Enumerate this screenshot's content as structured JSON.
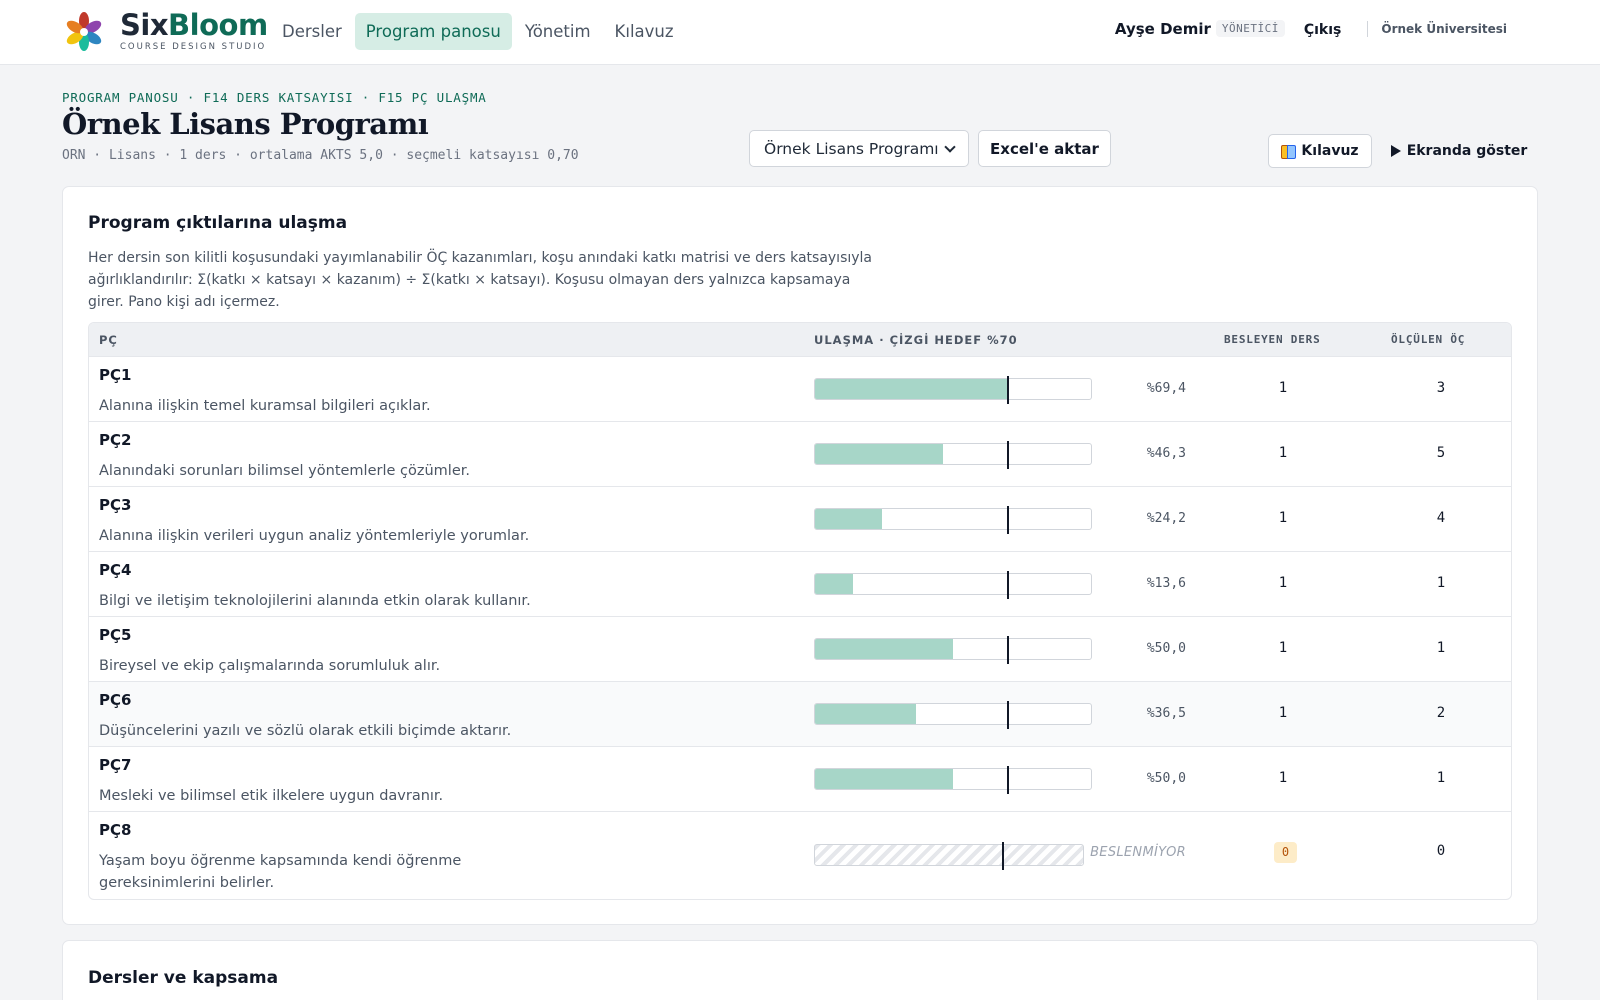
{
  "brand": {
    "name_part1": "Six",
    "name_part2": "Bloom",
    "tagline": "COURSE DESIGN STUDIO"
  },
  "nav": [
    {
      "label": "Dersler",
      "active": false
    },
    {
      "label": "Program panosu",
      "active": true
    },
    {
      "label": "Yönetim",
      "active": false
    },
    {
      "label": "Kılavuz",
      "active": false
    }
  ],
  "user": {
    "name": "Ayşe Demir",
    "role": "YÖNETİCİ",
    "logout": "Çıkış",
    "university": "Örnek Üniversitesi"
  },
  "header": {
    "breadcrumb": "PROGRAM PANOSU · F14 DERS KATSAYISI · F15 PÇ ULAŞMA",
    "title": "Örnek Lisans Programı",
    "subtitle": "ORN · Lisans · 1 ders · ortalama AKTS 5,0 · seçmeli katsayısı 0,70",
    "program_select": "Örnek Lisans Programı",
    "export_button": "Excel'e aktar",
    "guide_button": "Kılavuz",
    "present_button": "Ekranda göster"
  },
  "outcomes_card": {
    "title": "Program çıktılarına ulaşma",
    "description": "Her dersin son kilitli koşusundaki yayımlanabilir ÖÇ kazanımları, koşu anındaki katkı matrisi ve ders katsayısıyla ağırlıklandırılır: Σ(katkı × katsayı × kazanım) ÷ Σ(katkı × katsayı). Koşusu olmayan ders yalnızca kapsamaya girer. Pano kişi adı içermez.",
    "columns": {
      "pc": "PÇ",
      "achievement": "ULAŞMA · ÇİZGİ HEDEF %70",
      "feeding": "BESLEYEN DERS",
      "measured": "ÖLÇÜLEN ÖÇ"
    },
    "target": 0.7,
    "rows": [
      {
        "code": "PÇ1",
        "desc": "Alanına ilişkin temel kuramsal bilgileri açıklar.",
        "value": 0.694,
        "pct_label": "%69,4",
        "feeding": "1",
        "measured": "3"
      },
      {
        "code": "PÇ2",
        "desc": "Alanındaki sorunları bilimsel yöntemlerle çözümler.",
        "value": 0.463,
        "pct_label": "%46,3",
        "feeding": "1",
        "measured": "5"
      },
      {
        "code": "PÇ3",
        "desc": "Alanına ilişkin verileri uygun analiz yöntemleriyle yorumlar.",
        "value": 0.242,
        "pct_label": "%24,2",
        "feeding": "1",
        "measured": "4"
      },
      {
        "code": "PÇ4",
        "desc": "Bilgi ve iletişim teknolojilerini alanında etkin olarak kullanır.",
        "value": 0.136,
        "pct_label": "%13,6",
        "feeding": "1",
        "measured": "1"
      },
      {
        "code": "PÇ5",
        "desc": "Bireysel ve ekip çalışmalarında sorumluluk alır.",
        "value": 0.5,
        "pct_label": "%50,0",
        "feeding": "1",
        "measured": "1"
      },
      {
        "code": "PÇ6",
        "desc": "Düşüncelerini yazılı ve sözlü olarak etkili biçimde aktarır.",
        "value": 0.365,
        "pct_label": "%36,5",
        "feeding": "1",
        "measured": "2"
      },
      {
        "code": "PÇ7",
        "desc": "Mesleki ve bilimsel etik ilkelere uygun davranır.",
        "value": 0.5,
        "pct_label": "%50,0",
        "feeding": "1",
        "measured": "1"
      },
      {
        "code": "PÇ8",
        "desc": "Yaşam boyu öğrenme kapsamında kendi öğrenme gereksinimlerini belirler.",
        "value": null,
        "pct_label": "BESLENMİYOR",
        "feeding": "0",
        "measured": "0"
      }
    ]
  },
  "courses_card": {
    "title": "Dersler ve kapsama"
  },
  "colors": {
    "accent": "#0f6b57",
    "accent_bg": "#d6ede5",
    "bar_fill": "#a7d6c8",
    "warning_bg": "#fdecc8"
  }
}
